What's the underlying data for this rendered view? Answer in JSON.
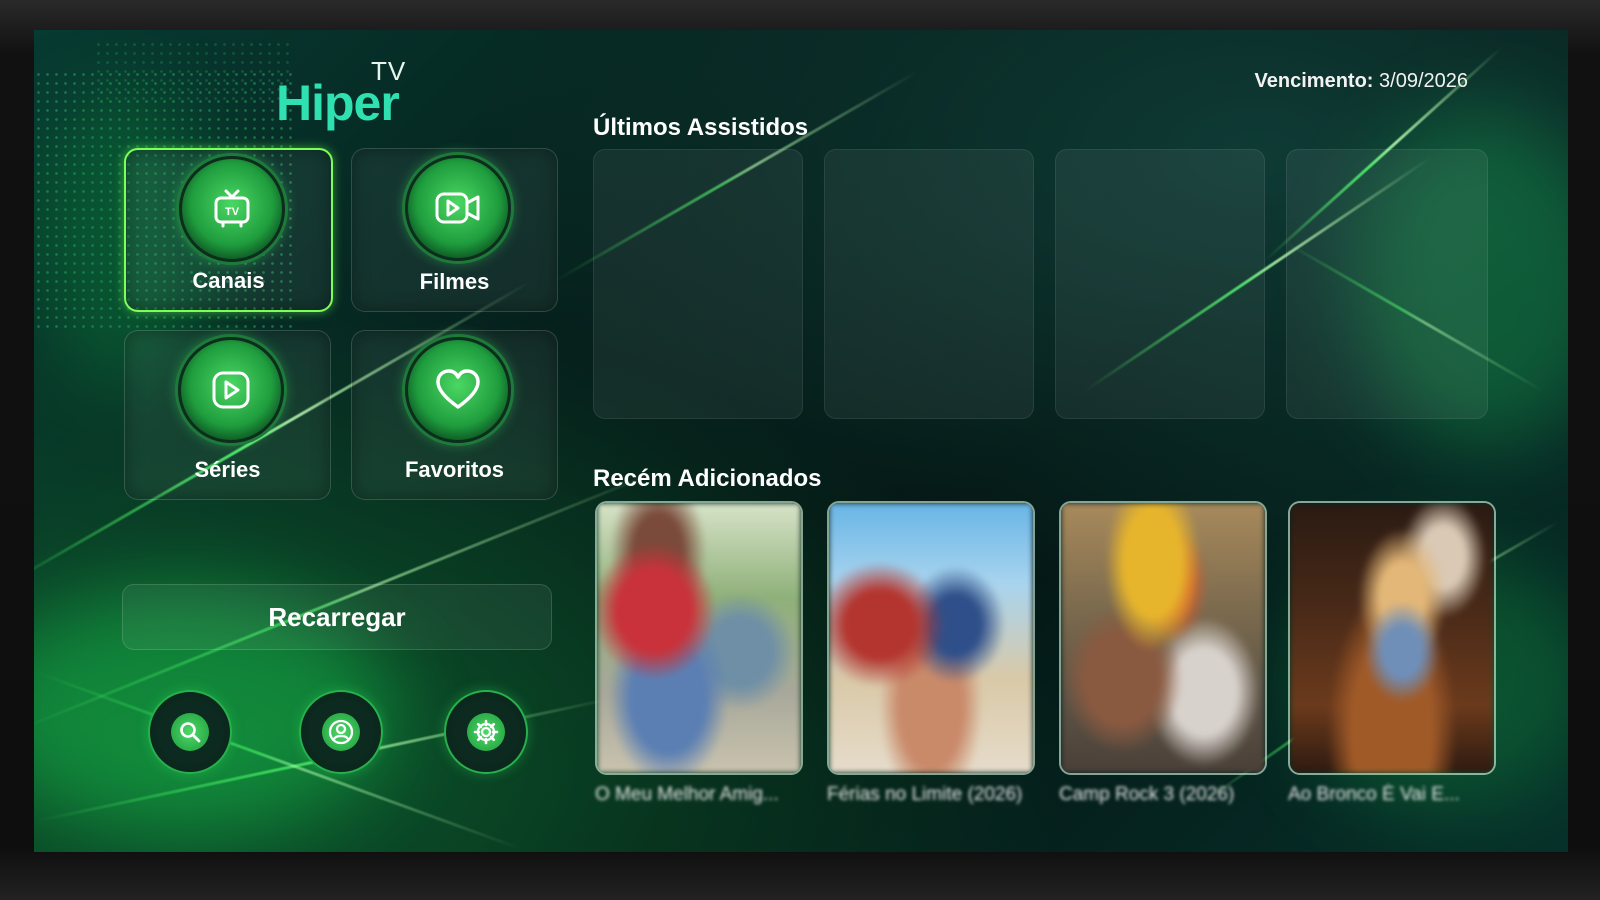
{
  "app": {
    "logo_tv": "TV",
    "logo_name": "Hiper"
  },
  "header": {
    "expiry_label": "Vencimento:",
    "expiry_value": "3/09/2026"
  },
  "menu": {
    "items": [
      {
        "label": "Canais",
        "icon": "tv-icon",
        "active": true
      },
      {
        "label": "Filmes",
        "icon": "video-camera-icon",
        "active": false
      },
      {
        "label": "Séries",
        "icon": "play-icon",
        "active": false
      },
      {
        "label": "Favoritos",
        "icon": "heart-icon",
        "active": false
      }
    ]
  },
  "reload_label": "Recarregar",
  "bottom_buttons": [
    {
      "icon": "search-icon"
    },
    {
      "icon": "user-profile-icon"
    },
    {
      "icon": "gear-icon"
    }
  ],
  "recent": {
    "title": "Últimos Assistidos"
  },
  "added": {
    "title": "Recém Adicionados",
    "items": [
      {
        "title": "O Meu Melhor Amig..."
      },
      {
        "title": "Férias no Limite (2026)"
      },
      {
        "title": "Camp Rock 3 (2026)"
      },
      {
        "title": "Ao Bronco É Vai E..."
      }
    ]
  },
  "colors": {
    "accent": "#2fe0b1",
    "active_border": "#7dff5a",
    "icon_green": "#1f9d3e"
  }
}
